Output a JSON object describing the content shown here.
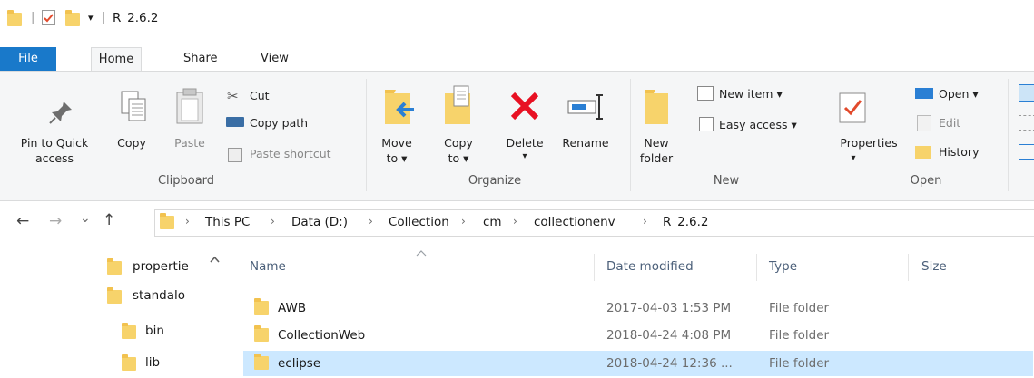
{
  "titlebar": {
    "title": "R_2.6.2",
    "qat_dropdown": "▾"
  },
  "ribbon_tabs": [
    "File",
    "Home",
    "Share",
    "View"
  ],
  "clipboard": {
    "pin_line1": "Pin to Quick",
    "pin_line2": "access",
    "copy": "Copy",
    "paste": "Paste",
    "cut": "Cut",
    "copy_path": "Copy path",
    "paste_shortcut": "Paste shortcut",
    "group": "Clipboard"
  },
  "organize": {
    "move_line1": "Move",
    "move_line2": "to ▾",
    "copy_line1": "Copy",
    "copy_line2": "to ▾",
    "delete": "Delete",
    "delete_arrow": "▾",
    "rename": "Rename",
    "group": "Organize"
  },
  "new": {
    "folder_line1": "New",
    "folder_line2": "folder",
    "new_item": "New item ▾",
    "easy_access": "Easy access ▾",
    "group": "New"
  },
  "open": {
    "properties": "Properties",
    "properties_arrow": "▾",
    "open": "Open ▾",
    "edit": "Edit",
    "history": "History",
    "group": "Open"
  },
  "address": {
    "back": "←",
    "forward": "→",
    "recent": "⌄",
    "up": "↑",
    "crumbs": [
      "This PC",
      "Data (D:)",
      "Collection",
      "cm",
      "collectionenv",
      "R_2.6.2"
    ]
  },
  "nav": {
    "items": [
      {
        "label": "propertie"
      },
      {
        "label": "standalo"
      },
      {
        "label": "bin"
      },
      {
        "label": "lib"
      }
    ]
  },
  "columns": {
    "name": "Name",
    "date": "Date modified",
    "type": "Type",
    "size": "Size"
  },
  "files": [
    {
      "name": "AWB",
      "date": "2017-04-03 1:53 PM",
      "type": "File folder"
    },
    {
      "name": "CollectionWeb",
      "date": "2018-04-24 4:08 PM",
      "type": "File folder"
    },
    {
      "name": "eclipse",
      "date": "2018-04-24 12:36 ...",
      "type": "File folder",
      "selected": true
    }
  ],
  "colors": {
    "file_tab": "#1979ca",
    "selection": "#cce8ff",
    "folder": "#f7d36b",
    "delete_red": "#e81123"
  }
}
